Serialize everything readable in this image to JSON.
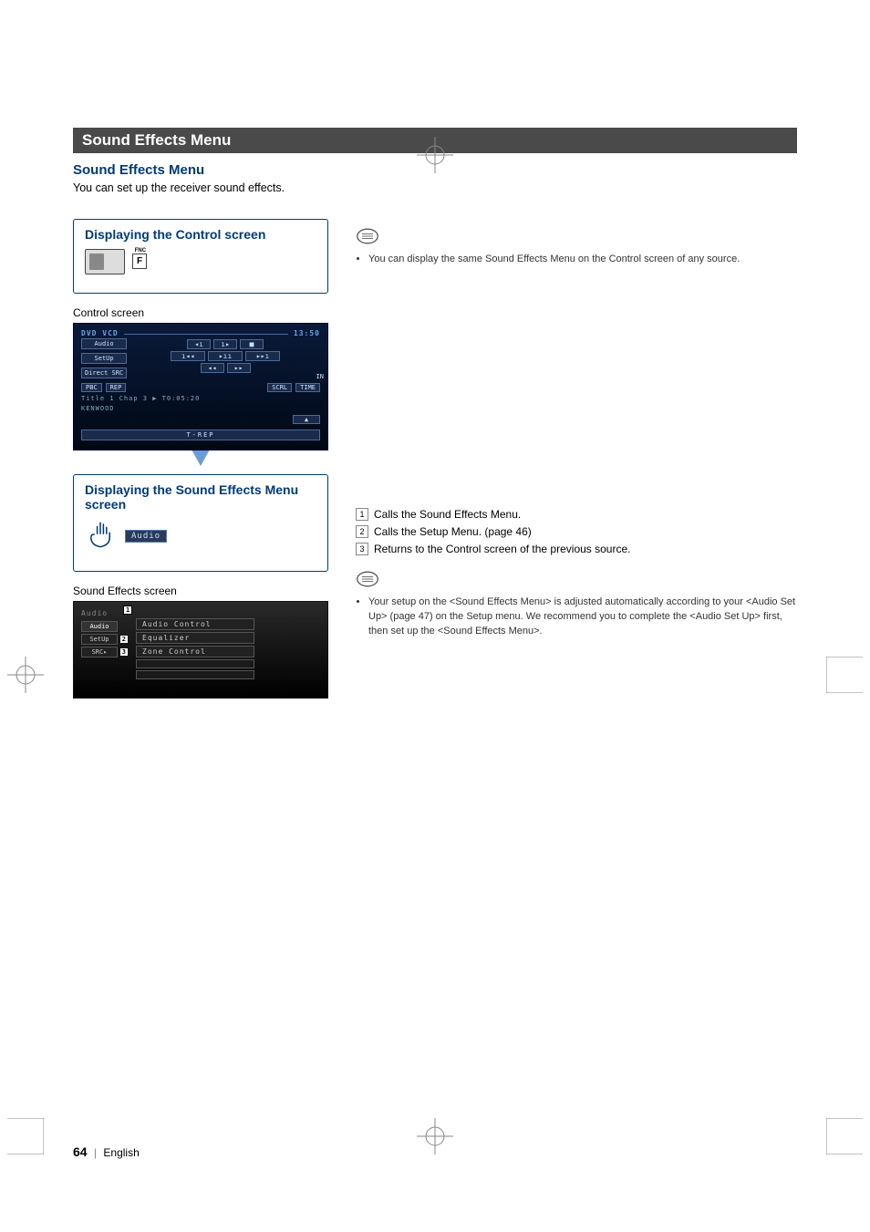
{
  "title_bar": "Sound Effects Menu",
  "section_heading": "Sound Effects Menu",
  "section_body": "You can set up the receiver sound effects.",
  "box1": {
    "title": "Displaying the Control screen",
    "fnc_small": "FNC",
    "fnc": "F",
    "caption": "Control screen",
    "screen": {
      "title": "DVD VCD",
      "time": "13:50",
      "side": {
        "audio": "Audio",
        "setup": "SetUp",
        "direct": "Direct SRC"
      },
      "in": "IN",
      "pbc_row": {
        "pbc": "PBC",
        "rep": "REP",
        "scrl": "SCRL",
        "tmode": "TIME"
      },
      "info1": "Title 1  Chap   3  ▶   T0:05:20",
      "info2": "KENWOOD",
      "trep": "T-REP"
    }
  },
  "right_note_1": "You can display the same Sound Effects Menu on the Control screen of any source.",
  "box2": {
    "title": "Displaying the Sound Effects Menu screen",
    "audio_pill": "Audio",
    "caption": "Sound Effects screen",
    "screen": {
      "header": "Audio",
      "tabs": {
        "audio": "Audio",
        "setup": "SetUp",
        "src": "SRC"
      },
      "callouts": {
        "c1": "1",
        "c2": "2",
        "c3": "3"
      },
      "menu": {
        "m1": "Audio Control",
        "m2": "Equalizer",
        "m3": "Zone Control"
      }
    }
  },
  "num_list": {
    "i1": "Calls the Sound Effects Menu.",
    "i2": "Calls the Setup Menu. (page 46)",
    "i3": "Returns to the Control screen of the previous source."
  },
  "right_note_2": "Your setup on the <Sound Effects Menu> is adjusted automatically according to your <Audio Set Up> (page 47) on the Setup menu. We recommend you to complete the <Audio Set Up> first, then set up the <Sound Effects Menu>.",
  "footer": {
    "page": "64",
    "lang": "English"
  }
}
